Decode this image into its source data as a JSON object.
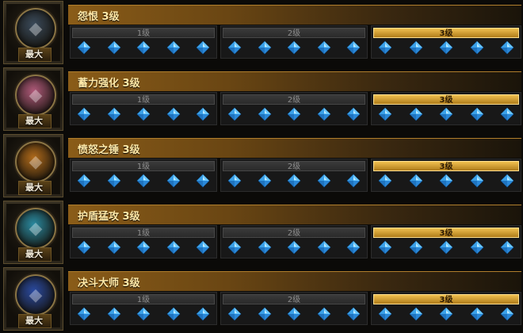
{
  "max_label": "最大",
  "skills": [
    {
      "name": "怨恨 3级",
      "portrait_icon": "dark-warrior-icon",
      "portrait_color": "#3a4a5a"
    },
    {
      "name": "蓄力强化 3级",
      "portrait_icon": "pink-fighter-icon",
      "portrait_color": "#b05a7a"
    },
    {
      "name": "愤怒之锤 3级",
      "portrait_icon": "hammer-icon",
      "portrait_color": "#b06a1a"
    },
    {
      "name": "护盾猛攻 3级",
      "portrait_icon": "shield-icon",
      "portrait_color": "#2a8aa0"
    },
    {
      "name": "决斗大师 3级",
      "portrait_icon": "duel-master-icon",
      "portrait_color": "#2a4aa0"
    }
  ],
  "tiers": [
    {
      "label": "1级",
      "active": false
    },
    {
      "label": "2级",
      "active": false
    },
    {
      "label": "3级",
      "active": true
    }
  ],
  "gems_per_tier": 5,
  "gem_icon": "blue-diamond-gem-icon",
  "colors": {
    "accent_gold": "#f0c050",
    "gem_blue": "#3aa0e8",
    "title_text": "#ffe9a8"
  }
}
